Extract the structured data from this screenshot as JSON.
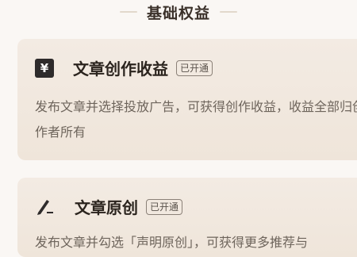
{
  "section": {
    "title": "基础权益"
  },
  "cards": [
    {
      "icon": "yen-icon",
      "icon_glyph": "¥",
      "title": "文章创作收益",
      "badge": "已开通",
      "description": "发布文章并选择投放广告，可获得创作收益，收益全部归创作者所有"
    },
    {
      "icon": "pen-edit-icon",
      "title": "文章原创",
      "badge": "已开通",
      "description": "发布文章并勾选「声明原创」，可获得更多推荐与"
    }
  ]
}
